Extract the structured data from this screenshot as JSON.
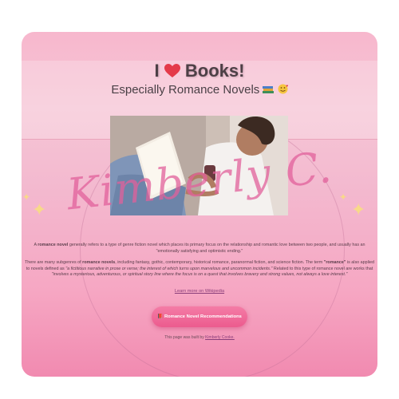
{
  "header": {
    "title_prefix": "I",
    "title_word": "Books!",
    "subtitle": "Especially Romance Novels"
  },
  "icons": {
    "heart": "red-heart-emoji",
    "books": "books-emoji",
    "smile": "smiling-face-with-hearts-emoji"
  },
  "watermark": {
    "signature": "Kimberly C."
  },
  "intro": {
    "lead": "A",
    "term": "romance novel",
    "rest": "generally refers to a type of genre fiction novel which places its primary focus on the relationship and romantic love between two people, and usually has an \"emotionally satisfying and optimistic ending.\""
  },
  "subgenres": {
    "lead": "There are many subgenres of",
    "term": "romance novels",
    "rest": ", including fantasy, gothic, contemporary, historical romance, paranormal fiction, and science fiction. The term",
    "term2": "\"romance\"",
    "rest2": "is also applied to novels defined as",
    "quote": "\"a fictitious narrative in prose or verse; the interest of which turns upon marvelous and uncommon incidents.\"",
    "rest3": "Related to this type of romance novel are works that",
    "quote2": "\"involves a mysterious, adventurous, or spiritual story line where the focus is on a quest that involves bravery and strong values, not always a love interest.\""
  },
  "link": {
    "label": "Learn more on Wikipedia"
  },
  "button": {
    "icon": "📕",
    "label": "Romance Novel Recommendations"
  },
  "footer": {
    "text": "This page was built by",
    "author": "Kimberly Cooke."
  },
  "colors": {
    "accent": "#ec5b8e",
    "card_top": "#f7b7cd",
    "card_bottom": "#f18ab0"
  }
}
